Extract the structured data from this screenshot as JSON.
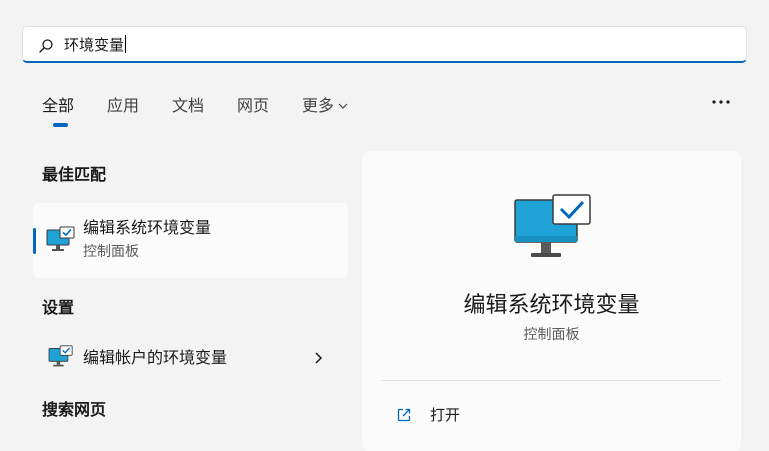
{
  "search": {
    "query": "环境变量"
  },
  "tabs": [
    {
      "label": "全部",
      "active": true
    },
    {
      "label": "应用"
    },
    {
      "label": "文档"
    },
    {
      "label": "网页"
    },
    {
      "label": "更多"
    }
  ],
  "sections": {
    "best_match": "最佳匹配",
    "settings": "设置",
    "web": "搜索网页"
  },
  "best_match_item": {
    "title": "编辑系统环境变量",
    "subtitle": "控制面板",
    "icon": "monitor-check-icon"
  },
  "settings_item": {
    "title": "编辑帐户的环境变量",
    "icon": "monitor-check-icon"
  },
  "detail": {
    "title": "编辑系统环境变量",
    "subtitle": "控制面板",
    "actions": [
      {
        "label": "打开",
        "icon": "open-external-icon"
      }
    ]
  },
  "colors": {
    "accent": "#0067c0",
    "monitor_screen": "#1fa3d6",
    "background": "#f3f3f3"
  }
}
